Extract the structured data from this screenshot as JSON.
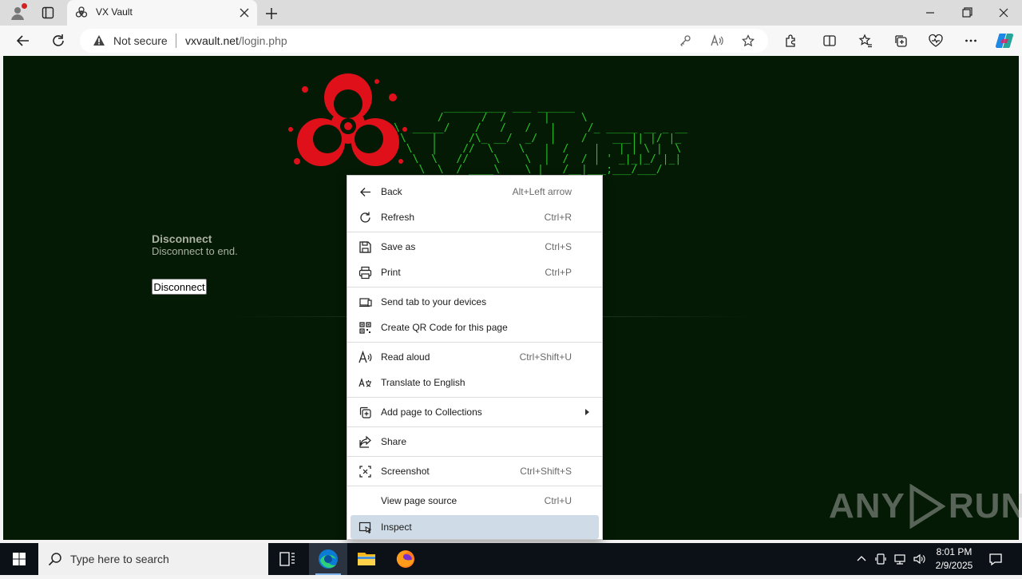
{
  "browser": {
    "tab": {
      "title": "VX Vault"
    },
    "address": {
      "security": "Not secure",
      "domain": "vxvault.net",
      "path": "/login.php"
    }
  },
  "page": {
    "ascii_art": "             __________ ___ ______\n            /      /  /      |     \\\n     \\  _____/    /   /   /   |     /_ _____ __ _ __\n      \\    |     /\\_ __/  _/  |    /    ___|| |/ |_\n       \\   |    //  \\    \\   |  /    |   | | \\ |  \\\n        \\  \\   //    \\    \\  |  /  / | ' _|_|_/ |_|\n         \\  \\  / ____\\    \\ |   /__|___;___/___/\n          \\  \\/           \\/ |  \\/",
    "section_title": "Disconnect",
    "section_desc": "Disconnect to end.",
    "button_label": "Disconnect",
    "watermark_left": "ANY",
    "watermark_right": "RUN"
  },
  "context_menu": {
    "items": [
      {
        "label": "Back",
        "shortcut": "Alt+Left arrow",
        "icon": "back-arrow-icon"
      },
      {
        "label": "Refresh",
        "shortcut": "Ctrl+R",
        "icon": "refresh-icon"
      },
      {
        "label": "Save as",
        "shortcut": "Ctrl+S",
        "icon": "save-icon"
      },
      {
        "label": "Print",
        "shortcut": "Ctrl+P",
        "icon": "printer-icon"
      },
      {
        "label": "Send tab to your devices",
        "shortcut": "",
        "icon": "devices-icon"
      },
      {
        "label": "Create QR Code for this page",
        "shortcut": "",
        "icon": "qr-code-icon"
      },
      {
        "label": "Read aloud",
        "shortcut": "Ctrl+Shift+U",
        "icon": "read-aloud-icon"
      },
      {
        "label": "Translate to English",
        "shortcut": "",
        "icon": "translate-icon"
      },
      {
        "label": "Add page to Collections",
        "shortcut": "",
        "icon": "collections-icon"
      },
      {
        "label": "Share",
        "shortcut": "",
        "icon": "share-icon"
      },
      {
        "label": "Screenshot",
        "shortcut": "Ctrl+Shift+S",
        "icon": "screenshot-icon"
      },
      {
        "label": "View page source",
        "shortcut": "Ctrl+U",
        "icon": ""
      },
      {
        "label": "Inspect",
        "shortcut": "",
        "icon": "inspect-icon"
      }
    ]
  },
  "taskbar": {
    "search_placeholder": "Type here to search",
    "time": "8:01 PM",
    "date": "2/9/2025"
  },
  "colors": {
    "page_bg": "#041a04",
    "ascii_green": "#29c429",
    "hazard_red": "#e0101a",
    "menu_highlight": "#cfdce8"
  }
}
